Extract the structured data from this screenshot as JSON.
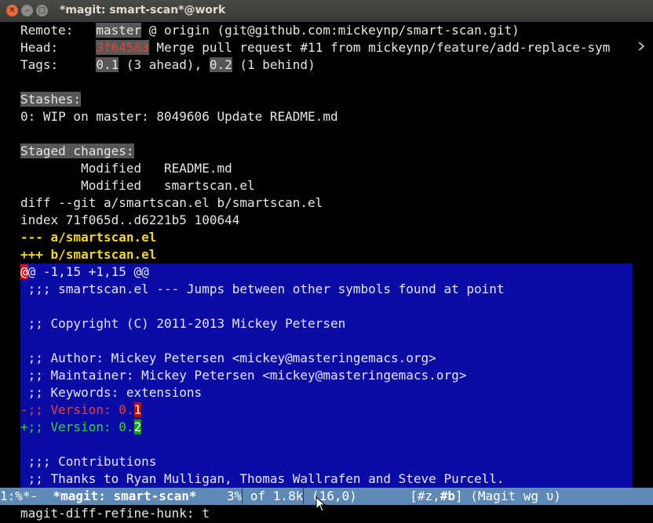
{
  "window": {
    "title": "*magit: smart-scan*@work",
    "close_glyph": "✕",
    "min_glyph": "–",
    "max_glyph": "□"
  },
  "status": {
    "remote": {
      "label": "Remote:   ",
      "branch": "master",
      "rest": " @ origin (git@github.com:mickeynp/smart-scan.git)"
    },
    "head": {
      "label": "Head:     ",
      "hash": "3f64583",
      "rest": " Merge pull request #11 from mickeynp/feature/add-replace-sym"
    },
    "tags": {
      "label": "Tags:     ",
      "tag1": "0.1",
      "mid": " (3 ahead), ",
      "tag2": "0.2",
      "end": " (1 behind)"
    }
  },
  "stashes": {
    "heading": "Stashes:",
    "items": [
      "0: WIP on master: 8049606 Update README.md"
    ]
  },
  "staged": {
    "heading": "Staged changes:",
    "files": [
      "        Modified   README.md",
      "        Modified   smartscan.el"
    ]
  },
  "diff": {
    "header": "diff --git a/smartscan.el b/smartscan.el",
    "index": "index 71f065d..d6221b5 100644",
    "minus_file": "--- a/smartscan.el",
    "plus_file": "+++ b/smartscan.el",
    "hunk_cursor": "@",
    "hunk_rest": "@ -1,15 +1,15 @@",
    "context": [
      " ;;; smartscan.el --- Jumps between other symbols found at point",
      "",
      " ;; Copyright (C) 2011-2013 Mickey Petersen",
      "",
      " ;; Author: Mickey Petersen <mickey@masteringemacs.org>",
      " ;; Maintainer: Mickey Petersen <mickey@masteringemacs.org>",
      " ;; Keywords: extensions"
    ],
    "removed": {
      "prefix": "-;; Version: 0.",
      "changed": "1"
    },
    "added": {
      "prefix": "+;; Version: 0.",
      "changed": "2"
    },
    "trailing": [
      "",
      " ;;; Contributions",
      " ;; Thanks to Ryan Mulligan, Thomas Wallrafen and Steve Purcell."
    ]
  },
  "modeline": {
    "left": "1:%*-  ",
    "buffer": "*magit: smart-scan*",
    "gap": "    3%",
    "size": " of 1.8k",
    "pos": " (16,0)",
    "spacer": "       ",
    "tags": "[#z,",
    "tag_b": "#b",
    "tags_end": "]",
    "mode": " (Magit wg υ)"
  },
  "minibuffer": {
    "text": "magit-diff-refine-hunk: t"
  }
}
